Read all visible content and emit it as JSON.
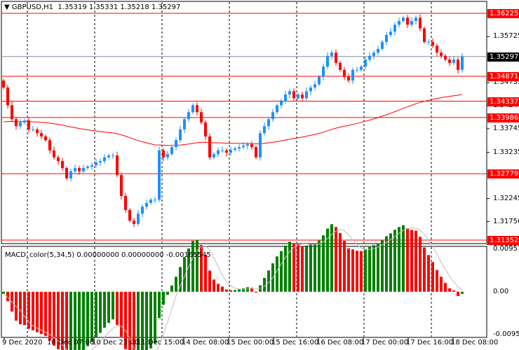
{
  "header": {
    "symbol": "GBPUSD,H1",
    "open": "1.35319",
    "high": "1.35331",
    "low": "1.35218",
    "close": "1.35297"
  },
  "macd": {
    "label": "MACD_color(5,34,5) 0.00000000 0.00000000 -0.00165545",
    "axis": [
      "0.0095146",
      "0.00",
      "-0.009586"
    ],
    "range": [
      -0.009586,
      0.0095146
    ]
  },
  "price_range": [
    1.31352,
    1.36225
  ],
  "current_price": "1.35297",
  "levels": [
    "1.36225",
    "1.34871",
    "1.34337",
    "1.33986",
    "1.32779",
    "1.31352"
  ],
  "price_ticks": [
    "1.35725",
    "1.34735",
    "1.34240",
    "1.33745",
    "1.33235",
    "1.32245",
    "1.31750",
    "1.31255"
  ],
  "time_labels": [
    "9 Dec 2020",
    "10 Dec 07:00",
    "10 Dec 23:00",
    "11 Dec 15:00",
    "14 Dec 08:00",
    "15 Dec 00:00",
    "15 Dec 16:00",
    "16 Dec 08:00",
    "17 Dec 00:00",
    "17 Dec 16:00",
    "18 Dec 08:00"
  ],
  "colors": {
    "bull": "#1e90ff",
    "bear": "#ff0000",
    "level": "#ff0000",
    "macd_up": "#008000",
    "macd_down": "#ff0000",
    "signal": "#c0c0c0",
    "ma": "#ff0000"
  },
  "closes": [
    1.3463,
    1.3425,
    1.3395,
    1.338,
    1.3388,
    1.3392,
    1.3373,
    1.3373,
    1.3365,
    1.3358,
    1.335,
    1.3328,
    1.3313,
    1.3305,
    1.329,
    1.3268,
    1.3283,
    1.329,
    1.3283,
    1.329,
    1.3293,
    1.3296,
    1.3302,
    1.3305,
    1.3313,
    1.3317,
    1.3317,
    1.3275,
    1.323,
    1.32,
    1.3177,
    1.317,
    1.3192,
    1.3207,
    1.3215,
    1.3222,
    1.3222,
    1.3328,
    1.3313,
    1.332,
    1.3335,
    1.335,
    1.3373,
    1.3395,
    1.341,
    1.3425,
    1.341,
    1.3388,
    1.3358,
    1.3313,
    1.332,
    1.3328,
    1.3328,
    1.3323,
    1.3329,
    1.3332,
    1.3335,
    1.3338,
    1.3341,
    1.3335,
    1.3313,
    1.3365,
    1.338,
    1.3395,
    1.341,
    1.3425,
    1.3433,
    1.3448,
    1.3455,
    1.344,
    1.3448,
    1.344,
    1.3455,
    1.3463,
    1.347,
    1.3486,
    1.3508,
    1.3531,
    1.3538,
    1.3516,
    1.3501,
    1.3486,
    1.3478,
    1.3501,
    1.3501,
    1.3508,
    1.3523,
    1.3531,
    1.3538,
    1.3546,
    1.3561,
    1.3576,
    1.3583,
    1.3598,
    1.3606,
    1.3613,
    1.3598,
    1.3606,
    1.3613,
    1.359,
    1.3561,
    1.3561,
    1.3553,
    1.3538,
    1.3531,
    1.3523,
    1.3516,
    1.3523,
    1.3501,
    1.353
  ]
}
